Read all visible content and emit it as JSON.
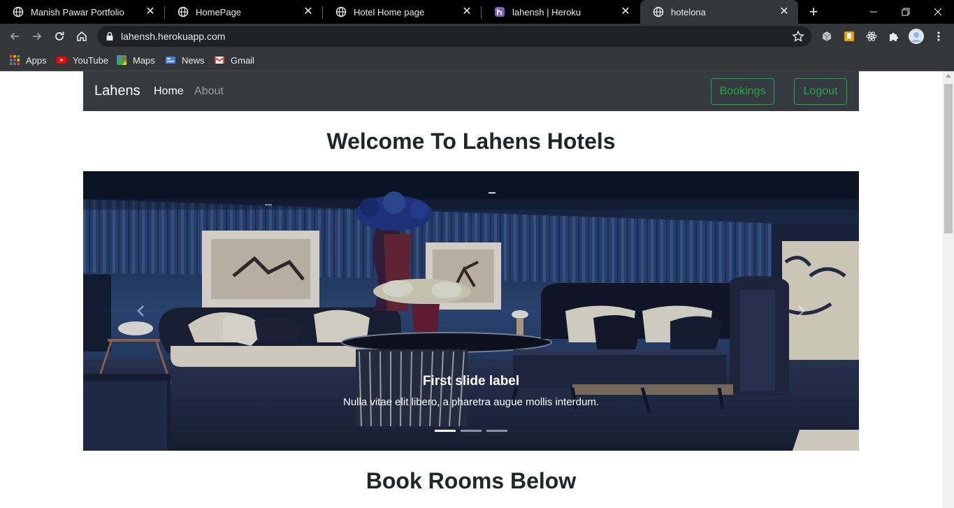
{
  "browser": {
    "tabs": [
      {
        "title": "Manish Pawar Portfolio",
        "active": false
      },
      {
        "title": "HomePage",
        "active": false
      },
      {
        "title": "Hotel Home page",
        "active": false
      },
      {
        "title": "lahensh | Heroku",
        "active": false
      },
      {
        "title": "hotelona",
        "active": true
      }
    ],
    "url": "lahensh.herokuapp.com",
    "bookmarks": [
      "Apps",
      "YouTube",
      "Maps",
      "News",
      "Gmail"
    ],
    "icons": {
      "tab_favicon": "globe-icon",
      "heroku_favicon": "heroku-icon",
      "back": "arrow-left-icon",
      "forward": "arrow-right-icon",
      "reload": "reload-icon",
      "home": "home-icon",
      "lock": "lock-icon",
      "bookmark_star": "star-icon",
      "extensions": [
        "cube-icon",
        "bookmark-ext-icon",
        "react-icon",
        "puzzle-icon",
        "avatar",
        "kebab-menu-icon"
      ]
    }
  },
  "site": {
    "brand": "Lahens",
    "nav": [
      "Home",
      "About"
    ],
    "buttons": {
      "bookings": "Bookings",
      "logout": "Logout"
    },
    "welcome": "Welcome To Lahens Hotels",
    "carousel": {
      "caption_title": "First slide label",
      "caption_text": "Nulla vitae elit libero, a pharetra augue mollis interdum.",
      "slide_count": 3,
      "active_slide": 1
    },
    "section_heading": "Book Rooms Below"
  },
  "colors": {
    "navbar": "#343a40",
    "success": "#28a745",
    "tabstrip": "#000000",
    "toolbar": "#35363a"
  }
}
